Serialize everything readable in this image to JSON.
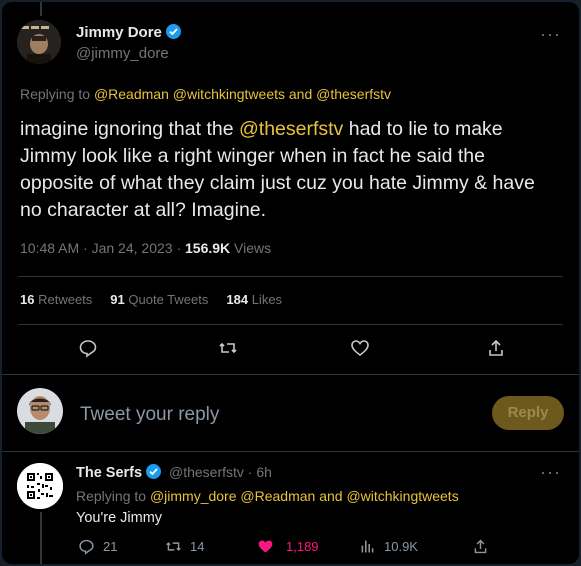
{
  "tweet": {
    "author_name": "Jimmy Dore",
    "author_handle": "@jimmy_dore",
    "replying_prefix": "Replying to",
    "replying_to": "@Readman @witchkingtweets and @theserfstv",
    "text_part1": "imagine ignoring that the ",
    "text_mention": "@theserfstv",
    "text_part2": " had to lie to make Jimmy look like a right winger when in fact he said the opposite of what they claim just cuz you hate Jimmy & have no character at all? Imagine.",
    "time": "10:48 AM · Jan 24, 2023 · ",
    "views_count": "156.9K",
    "views_label": " Views",
    "stats": {
      "retweets_count": "16",
      "retweets_label": "Retweets",
      "quotes_count": "91",
      "quotes_label": "Quote Tweets",
      "likes_count": "184",
      "likes_label": "Likes"
    }
  },
  "compose": {
    "placeholder": "Tweet your reply",
    "reply_button": "Reply"
  },
  "reply": {
    "author_name": "The Serfs",
    "author_handle": "@theserfstv",
    "time": "· 6h",
    "replying_prefix": "Replying to",
    "replying_to": "@jimmy_dore @Readman and @witchkingtweets",
    "text": "You're Jimmy",
    "counts": {
      "replies": "21",
      "retweets": "14",
      "likes": "1,189",
      "views": "10.9K"
    }
  },
  "colors": {
    "accent": "#e7c23a",
    "like": "#f91880",
    "background": "#000000",
    "secondary": "#71767b"
  }
}
